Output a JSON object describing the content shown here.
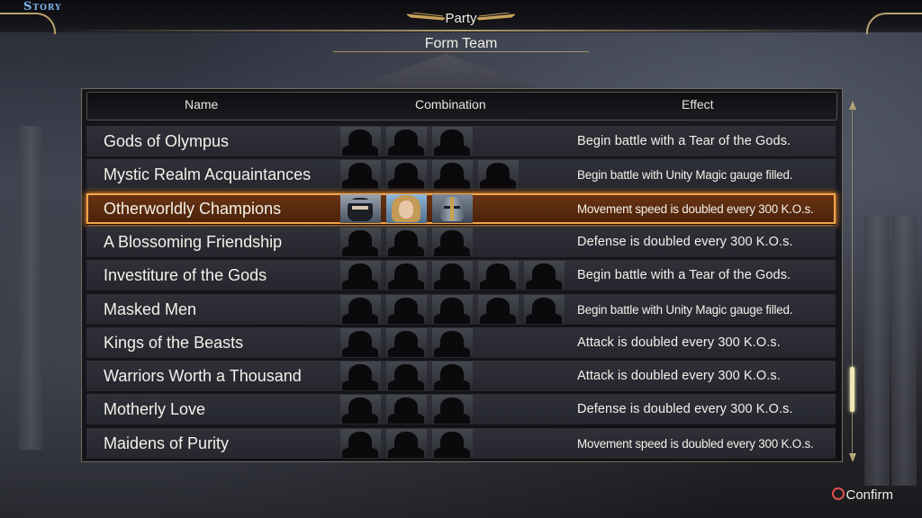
{
  "top_bar": {
    "mode_label": "Story",
    "screen_title": "Party"
  },
  "sub_title": "Form Team",
  "table": {
    "headers": {
      "name": "Name",
      "combination": "Combination",
      "effect": "Effect"
    },
    "rows": [
      {
        "name": "Gods of Olympus",
        "portraits": 3,
        "effect": "Begin battle with a Tear of the Gods."
      },
      {
        "name": "Mystic Realm Acquaintances",
        "portraits": 4,
        "effect": "Begin battle with Unity Magic gauge filled."
      },
      {
        "name": "Otherworldly Champions",
        "portraits": 3,
        "effect": "Movement speed is doubled every 300 K.O.s.",
        "selected": true,
        "revealed": [
          "ninja-icon",
          "woman-warrior-icon",
          "knight-icon"
        ]
      },
      {
        "name": "A Blossoming Friendship",
        "portraits": 3,
        "effect": "Defense is doubled every 300 K.O.s."
      },
      {
        "name": "Investiture of the Gods",
        "portraits": 5,
        "effect": "Begin battle with a Tear of the Gods."
      },
      {
        "name": "Masked Men",
        "portraits": 5,
        "effect": "Begin battle with Unity Magic gauge filled."
      },
      {
        "name": "Kings of the Beasts",
        "portraits": 3,
        "effect": "Attack is doubled every 300 K.O.s."
      },
      {
        "name": "Warriors Worth a Thousand",
        "portraits": 3,
        "effect": "Attack is doubled every 300 K.O.s."
      },
      {
        "name": "Motherly Love",
        "portraits": 3,
        "effect": "Defense is doubled every 300 K.O.s."
      },
      {
        "name": "Maidens of Purity",
        "portraits": 3,
        "effect": "Movement speed is doubled every 300 K.O.s."
      }
    ]
  },
  "footer": {
    "confirm_label": "Confirm",
    "confirm_icon": "circle-button-icon"
  },
  "colors": {
    "selected_border": "#f3a64a",
    "story_label": "#7fb4ee",
    "confirm_circle": "#e0504c"
  }
}
